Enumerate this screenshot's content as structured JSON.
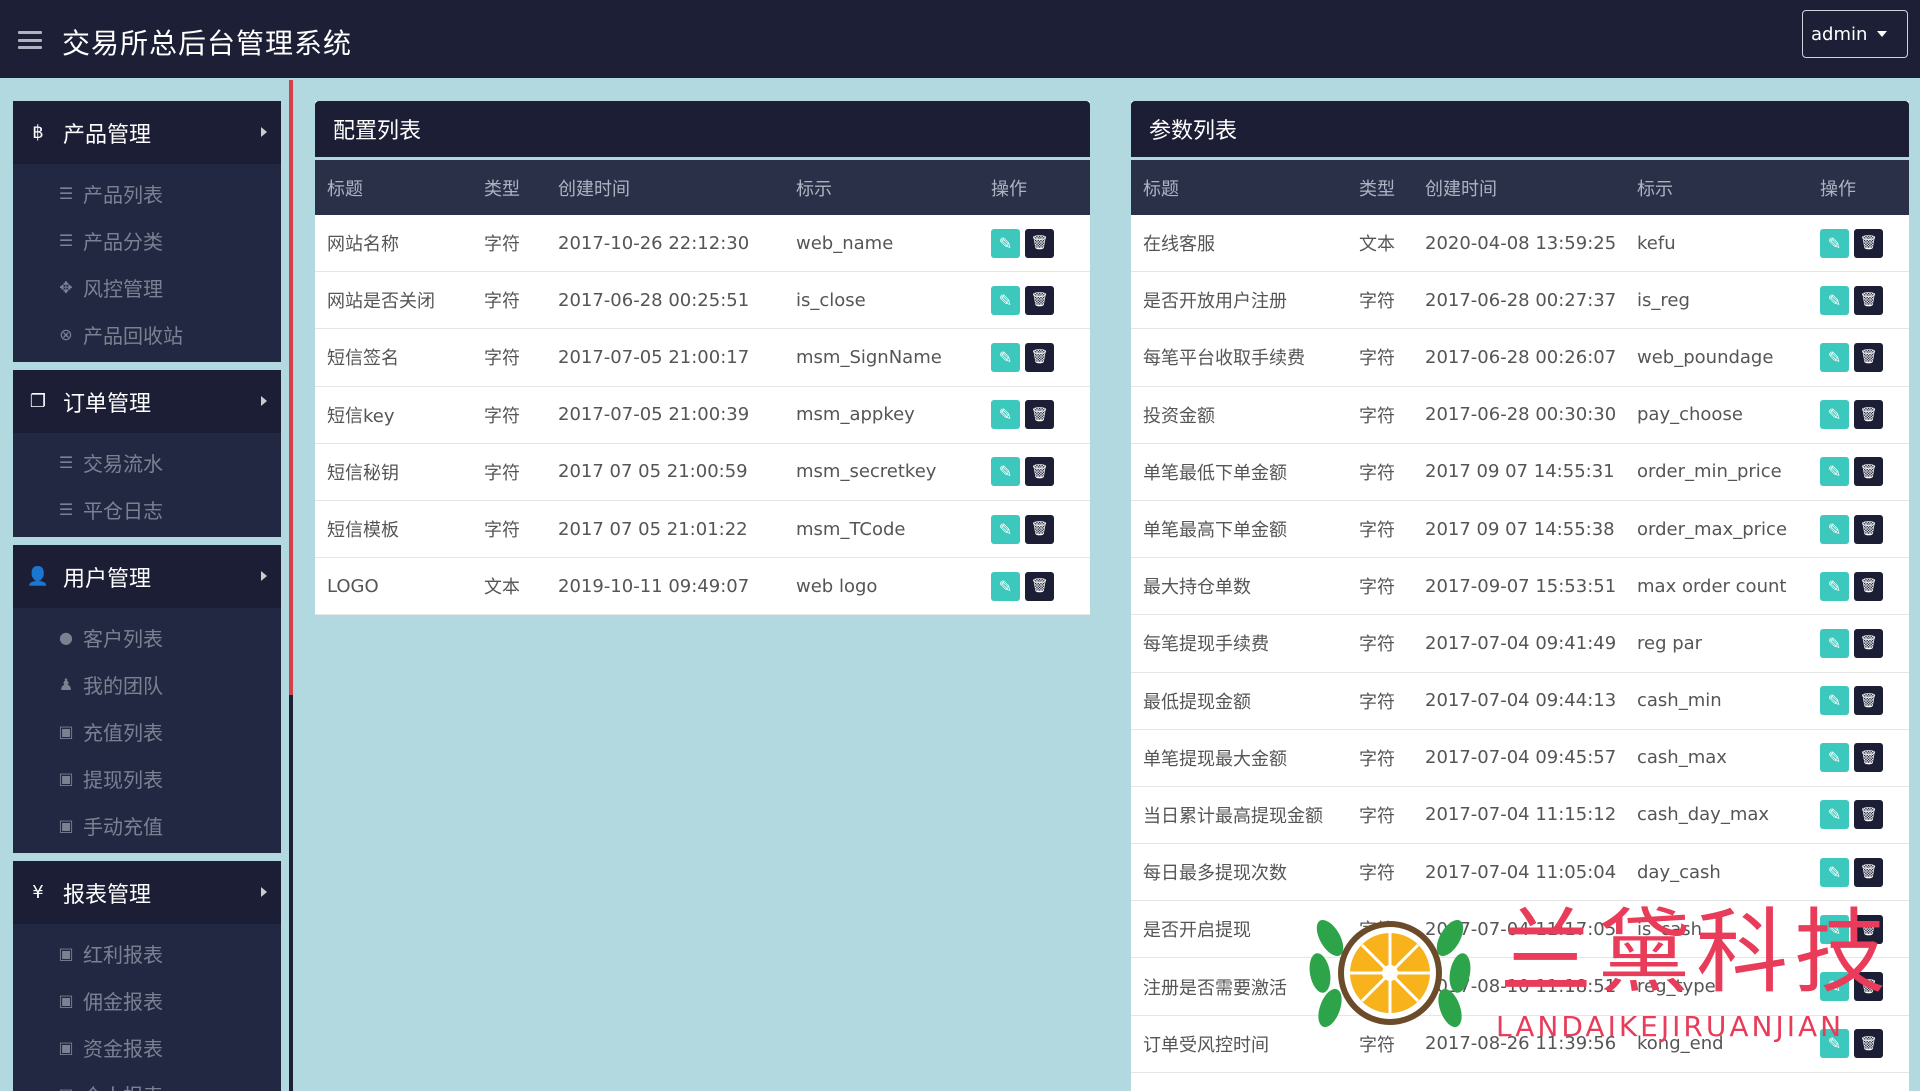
{
  "header": {
    "title": "交易所总后台管理系统",
    "user": "admin"
  },
  "sidebar": {
    "groups": [
      {
        "icon": "bitcoin-icon",
        "glyph": "฿",
        "label": "产品管理",
        "items": [
          {
            "icon": "list-icon",
            "glyph": "☰",
            "label": "产品列表"
          },
          {
            "icon": "list-icon",
            "glyph": "☰",
            "label": "产品分类"
          },
          {
            "icon": "move-icon",
            "glyph": "✥",
            "label": "风控管理"
          },
          {
            "icon": "circle-x-icon",
            "glyph": "⊗",
            "label": "产品回收站"
          }
        ]
      },
      {
        "icon": "copy-icon",
        "glyph": "❐",
        "label": "订单管理",
        "items": [
          {
            "icon": "list-icon",
            "glyph": "☰",
            "label": "交易流水"
          },
          {
            "icon": "list-icon",
            "glyph": "☰",
            "label": "平仓日志"
          }
        ]
      },
      {
        "icon": "user-icon",
        "glyph": "👤",
        "label": "用户管理",
        "items": [
          {
            "icon": "user-icon",
            "glyph": "●",
            "label": "客户列表"
          },
          {
            "icon": "team-icon",
            "glyph": "♟",
            "label": "我的团队"
          },
          {
            "icon": "money-icon",
            "glyph": "▣",
            "label": "充值列表"
          },
          {
            "icon": "money-icon",
            "glyph": "▣",
            "label": "提现列表"
          },
          {
            "icon": "money-icon",
            "glyph": "▣",
            "label": "手动充值"
          }
        ]
      },
      {
        "icon": "yen-icon",
        "glyph": "¥",
        "label": "报表管理",
        "items": [
          {
            "icon": "money-icon",
            "glyph": "▣",
            "label": "红利报表"
          },
          {
            "icon": "money-icon",
            "glyph": "▣",
            "label": "佣金报表"
          },
          {
            "icon": "money-icon",
            "glyph": "▣",
            "label": "资金报表"
          },
          {
            "icon": "money-icon",
            "glyph": "▣",
            "label": "个人报表"
          }
        ]
      }
    ]
  },
  "config_panel": {
    "title": "配置列表",
    "columns": [
      "标题",
      "类型",
      "创建时间",
      "标示",
      "操作"
    ],
    "rows": [
      {
        "title": "网站名称",
        "type": "字符",
        "created": "2017-10-26 22:12:30",
        "key": "web_name"
      },
      {
        "title": "网站是否关闭",
        "type": "字符",
        "created": "2017-06-28 00:25:51",
        "key": "is_close"
      },
      {
        "title": "短信签名",
        "type": "字符",
        "created": "2017-07-05 21:00:17",
        "key": "msm_SignName"
      },
      {
        "title": "短信key",
        "type": "字符",
        "created": "2017-07-05 21:00:39",
        "key": "msm_appkey"
      },
      {
        "title": "短信秘钥",
        "type": "字符",
        "created": "2017 07 05 21:00:59",
        "key": "msm_secretkey"
      },
      {
        "title": "短信模板",
        "type": "字符",
        "created": "2017 07 05 21:01:22",
        "key": "msm_TCode"
      },
      {
        "title": "LOGO",
        "type": "文本",
        "created": "2019-10-11 09:49:07",
        "key": "web logo"
      }
    ]
  },
  "param_panel": {
    "title": "参数列表",
    "columns": [
      "标题",
      "类型",
      "创建时间",
      "标示",
      "操作"
    ],
    "rows": [
      {
        "title": "在线客服",
        "type": "文本",
        "created": "2020-04-08 13:59:25",
        "key": "kefu"
      },
      {
        "title": "是否开放用户注册",
        "type": "字符",
        "created": "2017-06-28 00:27:37",
        "key": "is_reg"
      },
      {
        "title": "每笔平台收取手续费",
        "type": "字符",
        "created": "2017-06-28 00:26:07",
        "key": "web_poundage"
      },
      {
        "title": "投资金额",
        "type": "字符",
        "created": "2017-06-28 00:30:30",
        "key": "pay_choose"
      },
      {
        "title": "单笔最低下单金额",
        "type": "字符",
        "created": "2017 09 07 14:55:31",
        "key": "order_min_price"
      },
      {
        "title": "单笔最高下单金额",
        "type": "字符",
        "created": "2017 09 07 14:55:38",
        "key": "order_max_price"
      },
      {
        "title": "最大持仓单数",
        "type": "字符",
        "created": "2017-09-07 15:53:51",
        "key": "max order count"
      },
      {
        "title": "每笔提现手续费",
        "type": "字符",
        "created": "2017-07-04 09:41:49",
        "key": "reg par"
      },
      {
        "title": "最低提现金额",
        "type": "字符",
        "created": "2017-07-04 09:44:13",
        "key": "cash_min"
      },
      {
        "title": "单笔提现最大金额",
        "type": "字符",
        "created": "2017-07-04 09:45:57",
        "key": "cash_max"
      },
      {
        "title": "当日累计最高提现金额",
        "type": "字符",
        "created": "2017-07-04 11:15:12",
        "key": "cash_day_max"
      },
      {
        "title": "每日最多提现次数",
        "type": "字符",
        "created": "2017-07-04 11:05:04",
        "key": "day_cash"
      },
      {
        "title": "是否开启提现",
        "type": "字符",
        "created": "2017-07-04 11:17:05",
        "key": "is_cash"
      },
      {
        "title": "注册是否需要激活",
        "type": "字符",
        "created": "2017-08-10 11:18:51",
        "key": "reg_type"
      },
      {
        "title": "订单受风控时间",
        "type": "字符",
        "created": "2017-08-26 11:39:56",
        "key": "kong_end"
      }
    ]
  },
  "watermark": {
    "text": "兰黛科技",
    "sub": "LANDAIKEJIRUANJIAN"
  },
  "colors": {
    "topbar": "#1c1f35",
    "background": "#b2d8e0",
    "accent_red": "#d74145",
    "edit_button": "#3cc8bc"
  }
}
